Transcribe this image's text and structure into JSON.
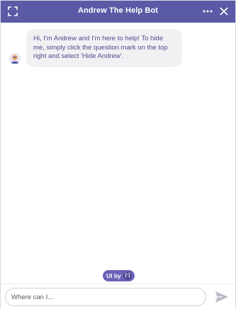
{
  "header": {
    "title": "Andrew The Help Bot",
    "expand_icon": "expand-icon",
    "more_icon": "more-horizontal-icon",
    "close_icon": "close-icon"
  },
  "messages": [
    {
      "sender": "bot",
      "avatar_icon": "bot-avatar-icon",
      "text": "Hi, I'm Andrew and I'm here to help! To hide me, simply click the question mark on the top right and select 'Hide Andrew'."
    }
  ],
  "branding": {
    "label": "UI by",
    "logo_glyph": "(·)"
  },
  "composer": {
    "placeholder": "Where can I...",
    "send_icon": "send-icon"
  },
  "colors": {
    "header_bg": "#5a5aa6",
    "bubble_bg": "#f1f1f4",
    "bubble_text": "#4a4a8a",
    "branding_bg": "#6b63b5"
  }
}
